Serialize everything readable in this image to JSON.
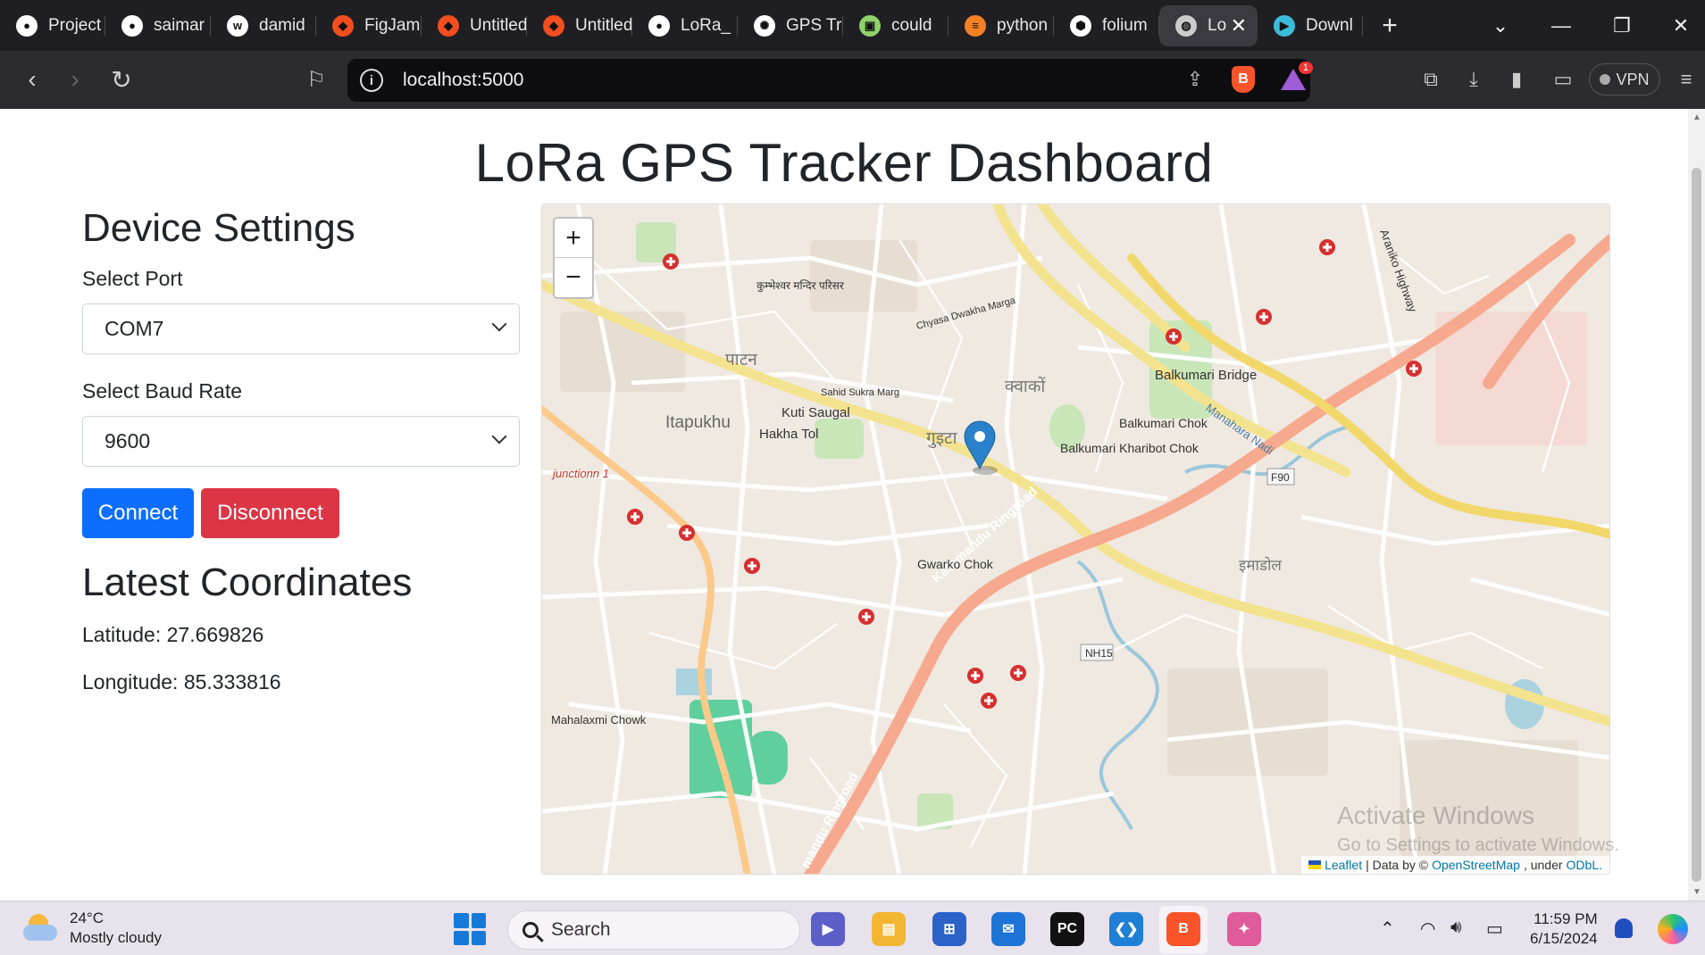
{
  "browser": {
    "tabs": [
      {
        "label": "Project",
        "icon": "github-icon",
        "color": "#ffffff"
      },
      {
        "label": "saimar",
        "icon": "github-icon",
        "color": "#ffffff"
      },
      {
        "label": "damid",
        "icon": "webflow-icon",
        "color": "#ffffff"
      },
      {
        "label": "FigJam",
        "icon": "figma-icon",
        "color": "#f24e1e"
      },
      {
        "label": "Untitled",
        "icon": "figma-icon",
        "color": "#f24e1e"
      },
      {
        "label": "Untitled",
        "icon": "figma-icon",
        "color": "#f24e1e"
      },
      {
        "label": "LoRa_",
        "icon": "github-icon",
        "color": "#ffffff"
      },
      {
        "label": "GPS Tr",
        "icon": "chatgpt-icon",
        "color": "#ffffff"
      },
      {
        "label": "could",
        "icon": "image-icon",
        "color": "#8fd16a"
      },
      {
        "label": "python",
        "icon": "stackoverflow-icon",
        "color": "#f48024"
      },
      {
        "label": "folium",
        "icon": "cube-icon",
        "color": "#ffffff"
      },
      {
        "label": "Lo",
        "icon": "globe-icon",
        "color": "#cccccc",
        "active": true
      },
      {
        "label": "Downl",
        "icon": "download-app-icon",
        "color": "#3bbcd8"
      }
    ],
    "url": "localhost:5000",
    "vpn_label": "VPN",
    "rewards_badge": "1"
  },
  "page": {
    "title": "LoRa GPS Tracker Dashboard",
    "settings": {
      "heading": "Device Settings",
      "port_label": "Select Port",
      "port_value": "COM7",
      "baud_label": "Select Baud Rate",
      "baud_value": "9600",
      "connect_label": "Connect",
      "disconnect_label": "Disconnect"
    },
    "coordinates": {
      "heading": "Latest Coordinates",
      "latitude": "Latitude: 27.669826",
      "longitude": "Longitude: 85.333816"
    },
    "map": {
      "zoom_in": "+",
      "zoom_out": "−",
      "attribution_leaflet": "Leaflet",
      "attribution_text": "| Data by ©",
      "attribution_osm": "OpenStreetMap",
      "attribution_under": ", under",
      "attribution_odbl": "ODbL.",
      "labels": {
        "ringroad_1": "Kathmandu Ringroad",
        "ringroad_2": "mandu Ringroad",
        "balkumari_bridge": "Balkumari Bridge",
        "balkumari_chok": "Balkumari Chok",
        "balkumari_kharibot": "Balkumari Kharibot Chok",
        "gwarko": "Gwarko Chok",
        "kuti_saugal": "Kuti Saugal",
        "hakha_tol": "Hakha Tol",
        "itapukhu": "Itapukhu",
        "junction": "junctionn 1",
        "mahalaxmi": "Mahalaxmi Chowk",
        "nh15": "NH15",
        "f90": "F90",
        "araniko": "Araniko Highway",
        "patan": "पाटन",
        "gutha": "गुइटा",
        "kwako": "क्वाकों",
        "imadol": "इमाडोल",
        "manohara": "Manahara Nadi",
        "chyasa": "Chyasa Dwakha Marga",
        "sahid_sukra": "Sahid Sukra Marg",
        "kumbheshwar": "कुम्भेश्वर मन्दिर परिसर"
      }
    }
  },
  "watermark": {
    "line1": "Activate Windows",
    "line2": "Go to Settings to activate Windows."
  },
  "taskbar": {
    "temperature": "24°C",
    "weather": "Mostly cloudy",
    "search_placeholder": "Search",
    "time": "11:59 PM",
    "date": "6/15/2024"
  }
}
